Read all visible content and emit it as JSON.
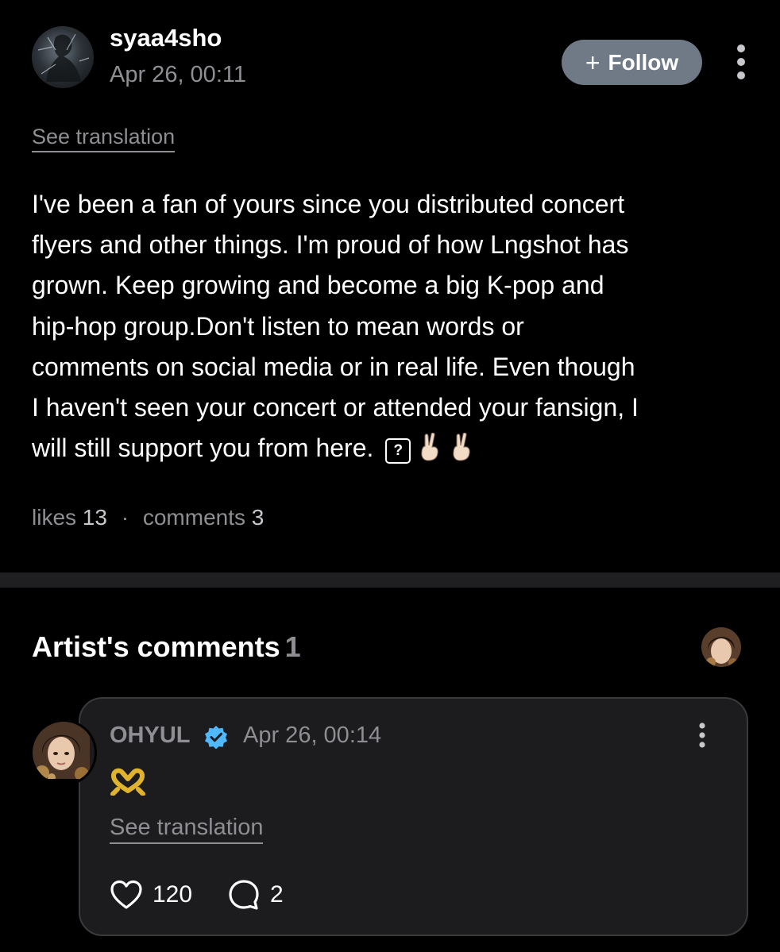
{
  "post": {
    "username": "syaa4sho",
    "date": "Apr 26, 00:11",
    "follow_label": "Follow",
    "see_translation": "See translation",
    "body_lines": [
      "I've been a fan of yours since you distributed concert",
      "flyers and other things. I'm proud of how Lngshot has",
      "grown. Keep growing and become a big K-pop and",
      "hip-hop group.Don't listen to mean words or",
      "comments on social media or in real life. Even though",
      "I haven't seen your concert or attended your fansign, I",
      "will still support you from here."
    ],
    "unknown_glyph": "?",
    "stats": {
      "likes_label": "likes",
      "likes_count": "13",
      "separator": "·",
      "comments_label": "comments",
      "comments_count": "3"
    }
  },
  "artist_comments": {
    "title": "Artist's comments",
    "count": "1",
    "comment": {
      "author": "OHYUL",
      "date": "Apr 26, 00:14",
      "see_translation": "See translation",
      "likes": "120",
      "replies": "2"
    }
  },
  "icons": {
    "follow": "plus-icon",
    "more": "vertical-ellipsis-icon",
    "verified": "verified-badge-icon",
    "reaction": "heart-hands-emoji",
    "victory": "victory-hand-emoji",
    "like": "heart-outline-icon",
    "reply": "speech-bubble-icon"
  },
  "colors": {
    "background": "#000000",
    "follow_button": "#6f7a86",
    "muted_text": "#8e8e93",
    "card_bg": "#1c1c1e",
    "verified": "#4fb8ff"
  }
}
